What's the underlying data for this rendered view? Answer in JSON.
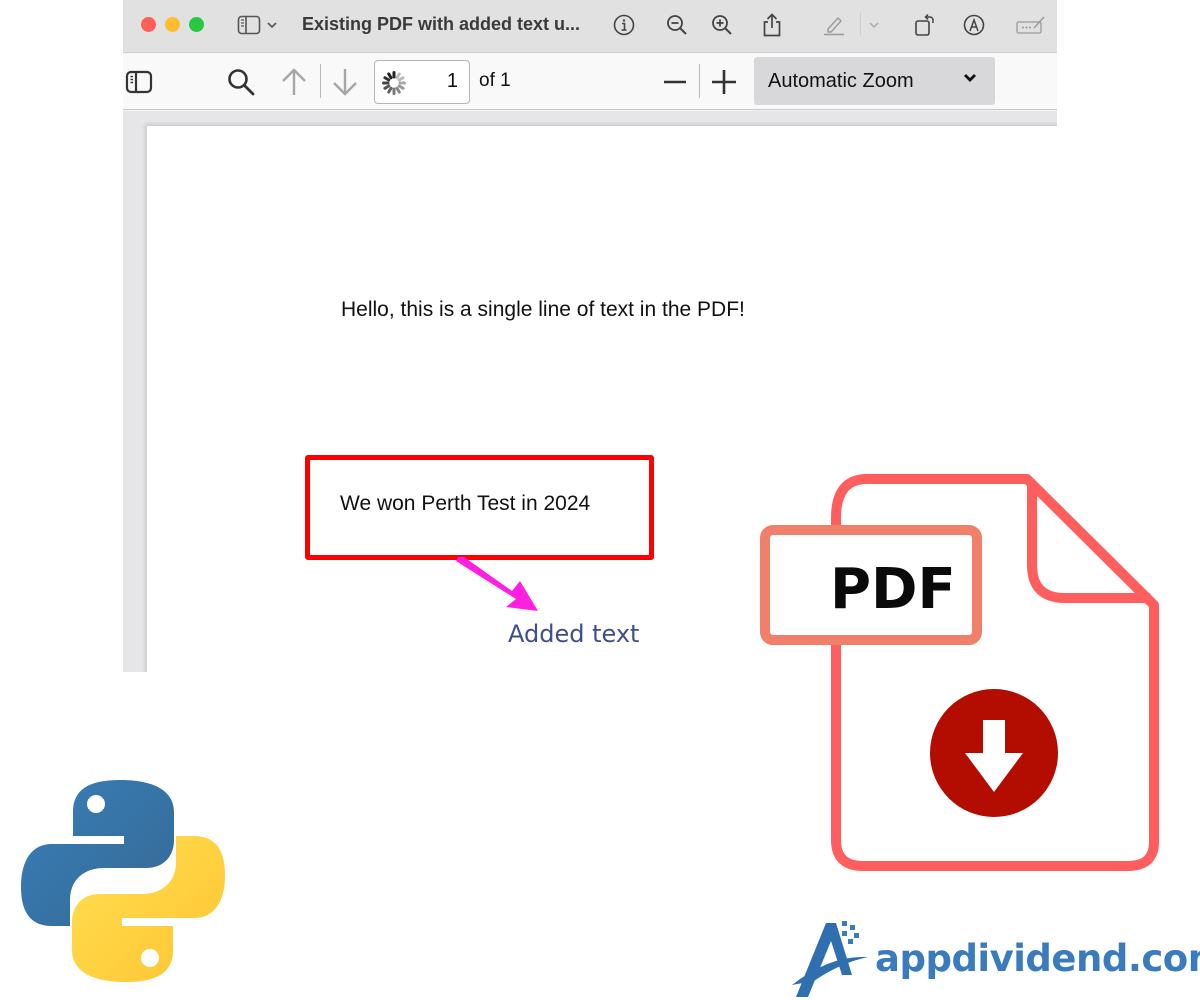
{
  "window": {
    "title": "Existing PDF with added text u...",
    "traffic_lights": [
      "close",
      "minimize",
      "zoom"
    ],
    "titlebar_icons": [
      "sidebar-icon",
      "chevron-down-icon",
      "info-icon",
      "zoom-out-icon",
      "zoom-in-icon",
      "share-icon",
      "highlight-pen-icon",
      "chevron-down-icon",
      "rotate-icon",
      "markup-icon",
      "form-fill-icon"
    ]
  },
  "pdf_toolbar": {
    "page_current": "1",
    "page_total_label": "of 1",
    "zoom_mode": "Automatic Zoom",
    "icons": [
      "sidebar-toggle-icon",
      "search-icon",
      "arrow-up-icon",
      "arrow-down-icon",
      "loading-spinner-icon",
      "minus-icon",
      "plus-icon",
      "chevron-down-icon"
    ]
  },
  "pdf_page": {
    "line1": "Hello, this is a single line of text in the PDF!",
    "highlighted_text": "We won Perth Test in 2024"
  },
  "annotation": {
    "label": "Added text",
    "box_color": "#ff0000",
    "arrow_color": "#ff1fe0",
    "label_color": "#3e4f8a"
  },
  "logos": {
    "pdf_icon_label": "PDF",
    "pdf_icon_color": "#ff5e5e",
    "pdf_tag_color": "#f0806a",
    "download_circle_color": "#b30c00",
    "site_name": "appdividend.com",
    "site_color": "#3a7bbd",
    "python_blue": "#3571a8",
    "python_yellow": "#ffd43b"
  }
}
